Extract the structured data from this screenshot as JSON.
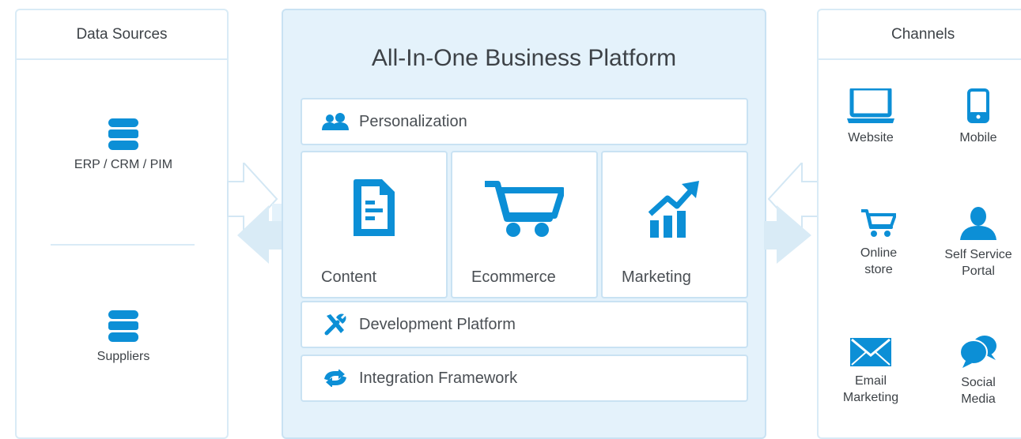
{
  "colors": {
    "accent": "#0c8fd6",
    "panel_border": "#d9ebf6",
    "platform_bg": "#e4f2fb"
  },
  "data_sources": {
    "title": "Data Sources",
    "items": [
      {
        "label": "ERP / CRM / PIM",
        "icon": "database-icon"
      },
      {
        "label": "Suppliers",
        "icon": "database-icon"
      }
    ]
  },
  "platform": {
    "title": "All-In-One Business Platform",
    "personalization": {
      "label": "Personalization",
      "icon": "users-icon"
    },
    "tiles": [
      {
        "label": "Content",
        "icon": "document-icon"
      },
      {
        "label": "Ecommerce",
        "icon": "cart-icon"
      },
      {
        "label": "Marketing",
        "icon": "chart-growth-icon"
      }
    ],
    "development": {
      "label": "Development Platform",
      "icon": "tools-icon"
    },
    "integration": {
      "label": "Integration Framework",
      "icon": "sync-icon"
    }
  },
  "channels": {
    "title": "Channels",
    "items": [
      {
        "line1": "Website",
        "line2": "",
        "icon": "laptop-icon"
      },
      {
        "line1": "Mobile",
        "line2": "",
        "icon": "mobile-icon"
      },
      {
        "line1": "Online",
        "line2": "store",
        "icon": "cart-icon"
      },
      {
        "line1": "Self Service",
        "line2": "Portal",
        "icon": "person-icon"
      },
      {
        "line1": "Email",
        "line2": "Marketing",
        "icon": "envelope-icon"
      },
      {
        "line1": "Social",
        "line2": "Media",
        "icon": "chat-bubbles-icon"
      }
    ]
  }
}
